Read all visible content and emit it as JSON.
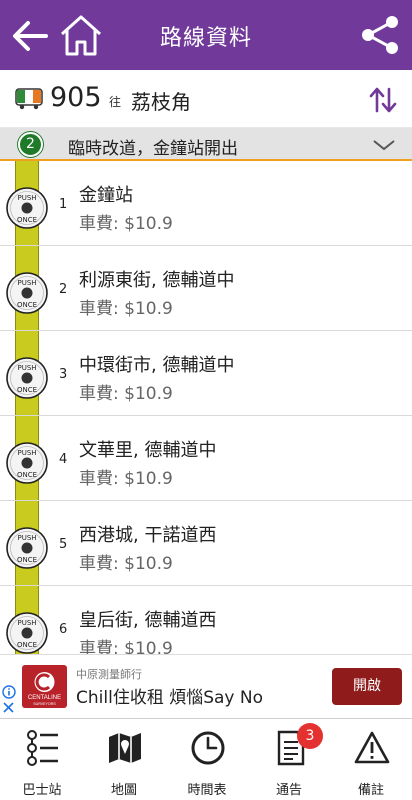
{
  "header": {
    "title": "路線資料"
  },
  "route": {
    "number": "905",
    "to_label": "往",
    "destination": "荔枝角"
  },
  "variant": {
    "badge": "2",
    "text": "臨時改道，金鐘站開出"
  },
  "stops": [
    {
      "seq": "1",
      "name": "金鐘站",
      "fare": "車費: $10.9"
    },
    {
      "seq": "2",
      "name": "利源東街, 德輔道中",
      "fare": "車費: $10.9"
    },
    {
      "seq": "3",
      "name": "中環街市, 德輔道中",
      "fare": "車費: $10.9"
    },
    {
      "seq": "4",
      "name": "文華里, 德輔道中",
      "fare": "車費: $10.9"
    },
    {
      "seq": "5",
      "name": "西港城, 干諾道西",
      "fare": "車費: $10.9"
    },
    {
      "seq": "6",
      "name": "皇后街, 德輔道西",
      "fare": "車費: $10.9"
    }
  ],
  "push_button": {
    "top_text": "PUSH",
    "bottom_text": "ONCE"
  },
  "ad": {
    "advertiser": "中原測量師行",
    "headline": "Chill住收租 煩惱Say No",
    "cta": "開啟",
    "logo_text": "CENTALINE",
    "logo_subtext": "SURVEYORS"
  },
  "nav": {
    "items": [
      {
        "label": "巴士站",
        "icon": "bus-stops-icon",
        "active": true
      },
      {
        "label": "地圖",
        "icon": "map-icon"
      },
      {
        "label": "時間表",
        "icon": "clock-icon"
      },
      {
        "label": "通告",
        "icon": "notice-icon",
        "badge": "3"
      },
      {
        "label": "備註",
        "icon": "warning-icon"
      }
    ]
  },
  "colors": {
    "header": "#71399a",
    "accent": "#f0a020",
    "route_badge": "#1f7a2a",
    "rail": "#c9cc1f",
    "ad_button": "#8f1b1b",
    "notif": "#e53030"
  }
}
